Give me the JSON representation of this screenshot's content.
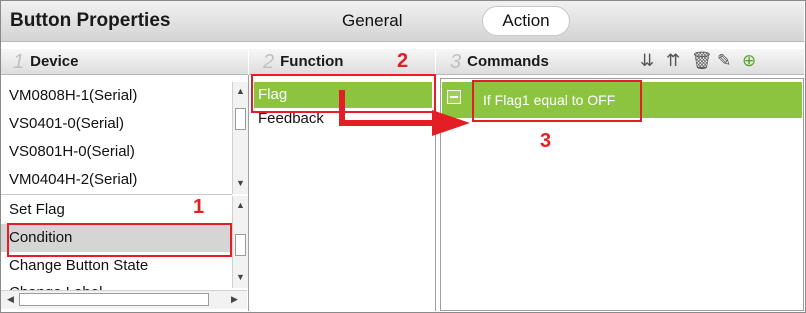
{
  "window": {
    "title": "Button Properties"
  },
  "tabs": [
    {
      "label": "General"
    },
    {
      "label": "Action"
    }
  ],
  "columns": {
    "device": {
      "number": "1",
      "label": "Device"
    },
    "function": {
      "number": "2",
      "label": "Function"
    },
    "commands": {
      "number": "3",
      "label": "Commands"
    }
  },
  "device_list": [
    "VM0808H-1(Serial)",
    "VS0401-0(Serial)",
    "VS0801H-0(Serial)",
    "VM0404H-2(Serial)"
  ],
  "action_list": [
    "Set Flag",
    "Condition",
    "Change Button State",
    "Change Label"
  ],
  "function_list": [
    "Flag",
    "Feedback"
  ],
  "commands": [
    {
      "text": "If Flag1 equal to OFF"
    }
  ],
  "toolbar_icons": [
    "move-down-icon",
    "move-up-icon",
    "delete-icon",
    "edit-icon",
    "add-icon"
  ],
  "annotations": [
    "1",
    "2",
    "3"
  ],
  "colors": {
    "selected_green": "#8cc43f",
    "highlight_red": "#e31e24",
    "selected_gray": "#d5d5d5"
  }
}
